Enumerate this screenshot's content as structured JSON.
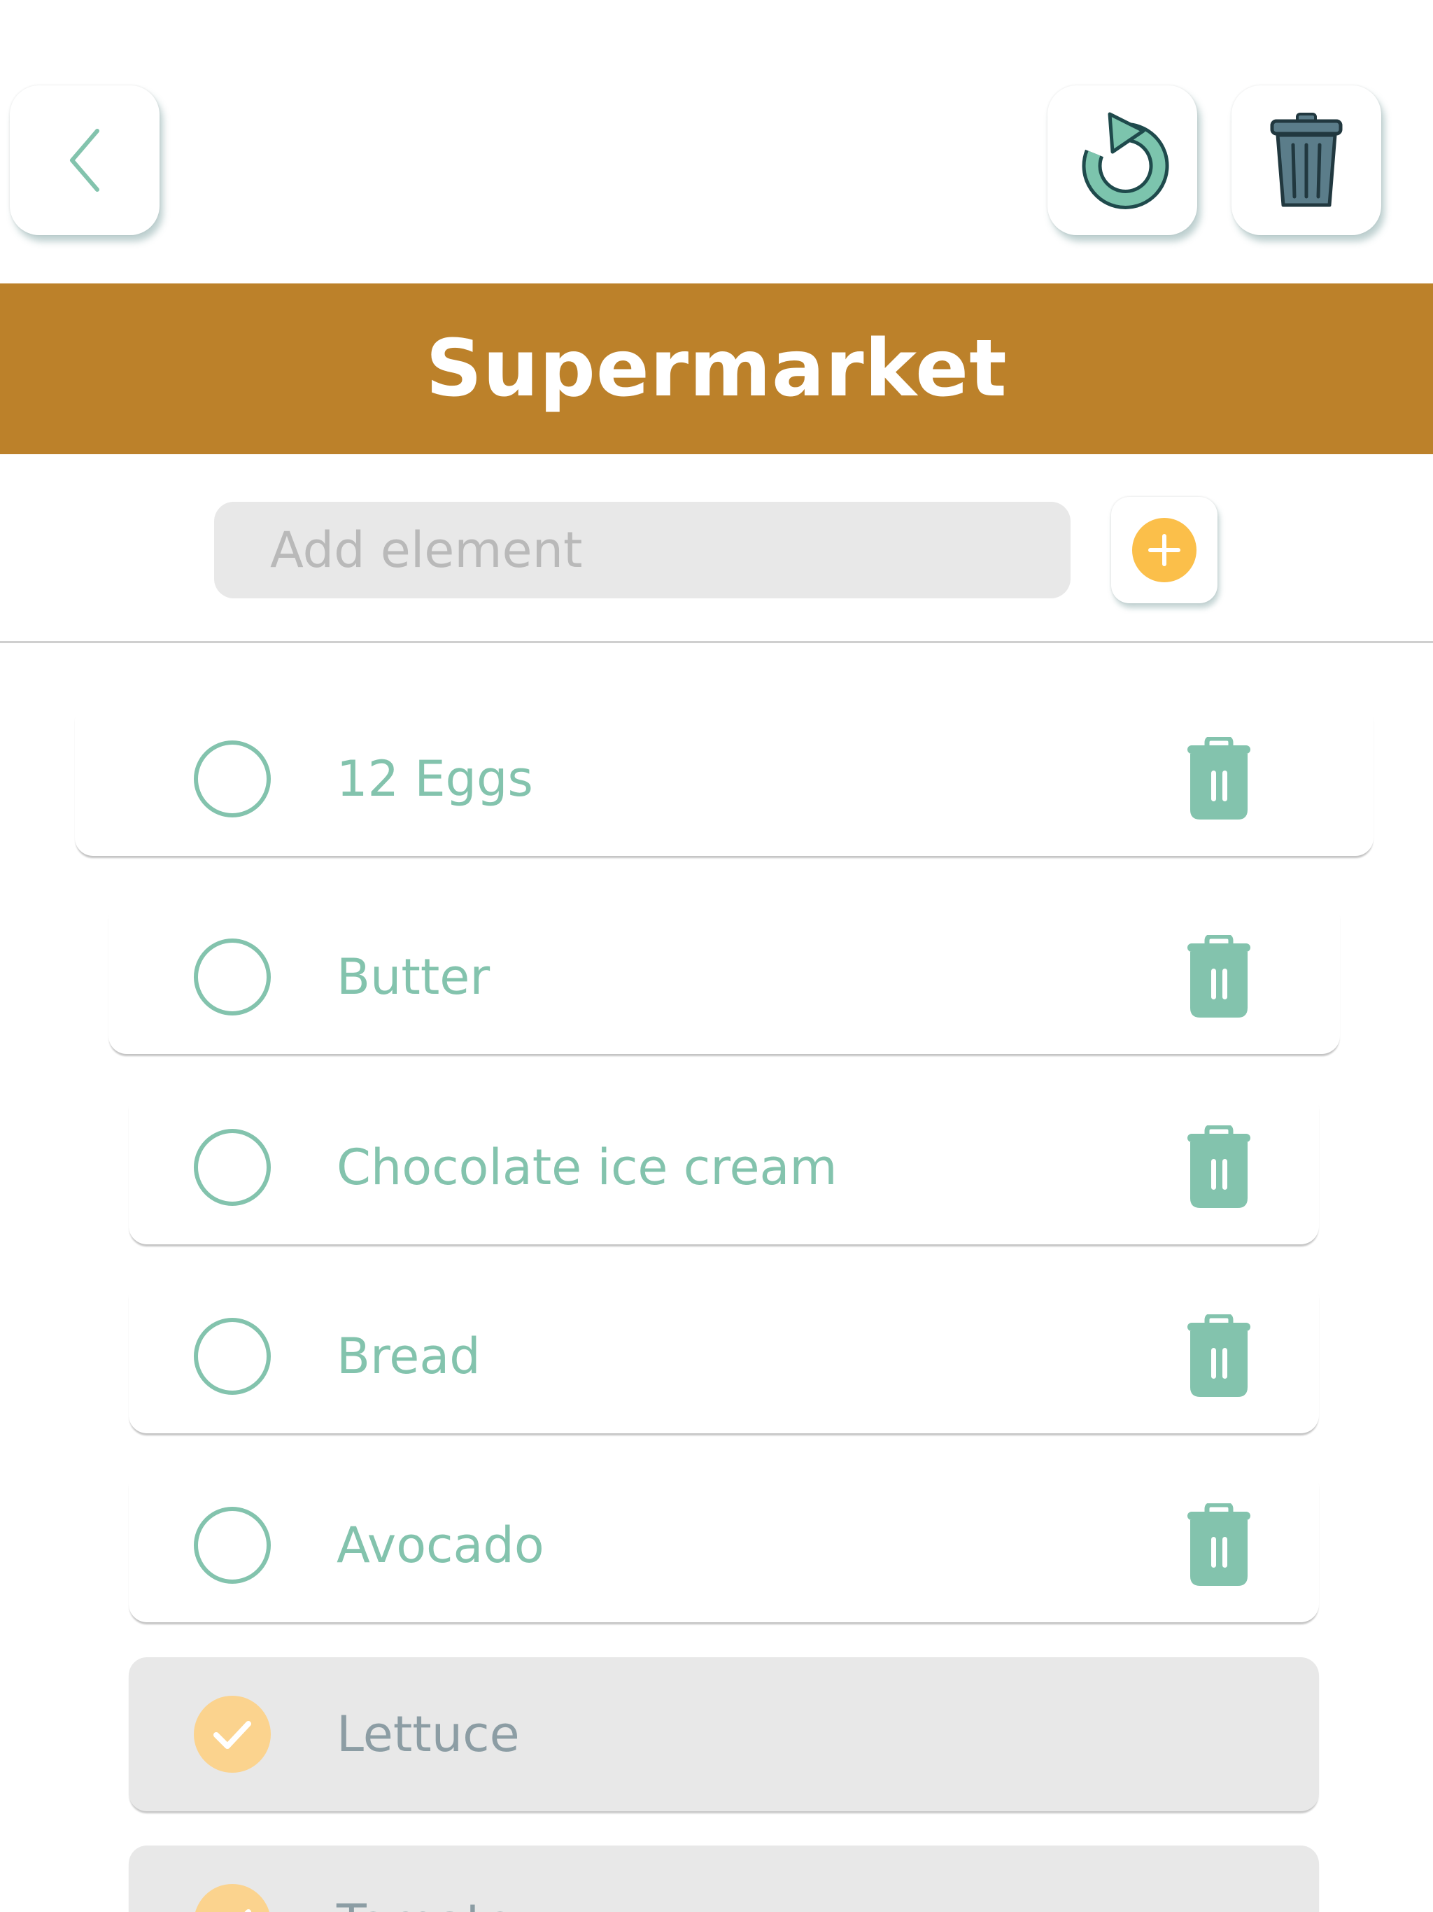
{
  "header": {
    "back_icon": "chevron-left-icon",
    "reset_icon": "rotate-cw-icon",
    "delete_all_icon": "trash-can-icon"
  },
  "title": "Supermarket",
  "add": {
    "placeholder": "Add element",
    "value": "",
    "button_icon": "plus-circle-icon"
  },
  "colors": {
    "title_bar": "#bc812a",
    "accent_teal": "#83c3ad",
    "accent_yellow": "#fbbf4a",
    "done_row": "#e8e8e8"
  },
  "items": [
    {
      "label": "12 Eggs",
      "done": false
    },
    {
      "label": "Butter",
      "done": false
    },
    {
      "label": "Chocolate ice cream",
      "done": false
    },
    {
      "label": "Bread",
      "done": false
    },
    {
      "label": "Avocado",
      "done": false
    },
    {
      "label": "Lettuce",
      "done": true
    },
    {
      "label": "Tomato",
      "done": true
    }
  ]
}
